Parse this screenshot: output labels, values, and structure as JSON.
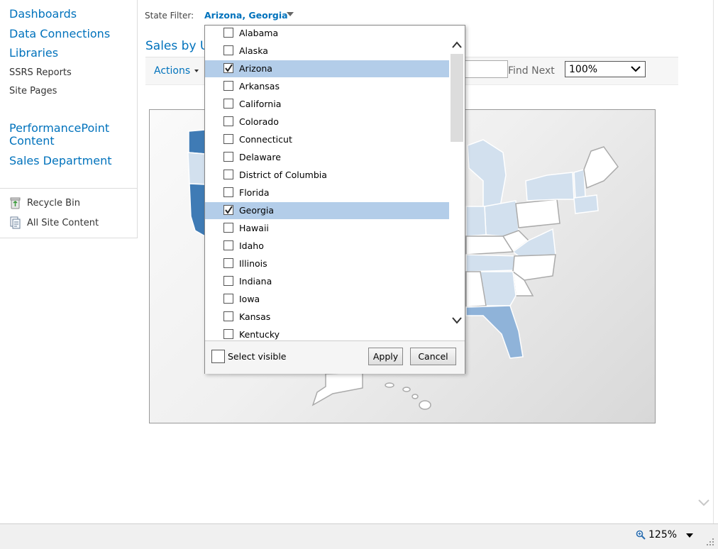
{
  "nav": {
    "items": [
      {
        "label": "Dashboards"
      },
      {
        "label": "Data Connections"
      },
      {
        "label": "Libraries"
      },
      {
        "label": "SSRS Reports"
      },
      {
        "label": "Site Pages"
      },
      {
        "label": "PerformancePoint Content"
      },
      {
        "label": "Sales Department"
      }
    ],
    "utility": [
      {
        "label": "Recycle Bin",
        "icon": "recycle-bin-icon"
      },
      {
        "label": "All Site Content",
        "icon": "site-content-icon"
      }
    ]
  },
  "filter": {
    "label": "State Filter:",
    "value": "Arizona, Georgia"
  },
  "report": {
    "title": "Sales by U"
  },
  "toolbar": {
    "actions_label": "Actions",
    "find_next_label": "Find Next",
    "find_value": "",
    "zoom_value": "100%"
  },
  "dropdown": {
    "options": [
      {
        "label": "Alabama",
        "checked": false
      },
      {
        "label": "Alaska",
        "checked": false
      },
      {
        "label": "Arizona",
        "checked": true
      },
      {
        "label": "Arkansas",
        "checked": false
      },
      {
        "label": "California",
        "checked": false
      },
      {
        "label": "Colorado",
        "checked": false
      },
      {
        "label": "Connecticut",
        "checked": false
      },
      {
        "label": "Delaware",
        "checked": false
      },
      {
        "label": "District of Columbia",
        "checked": false
      },
      {
        "label": "Florida",
        "checked": false
      },
      {
        "label": "Georgia",
        "checked": true
      },
      {
        "label": "Hawaii",
        "checked": false
      },
      {
        "label": "Idaho",
        "checked": false
      },
      {
        "label": "Illinois",
        "checked": false
      },
      {
        "label": "Indiana",
        "checked": false
      },
      {
        "label": "Iowa",
        "checked": false
      },
      {
        "label": "Kansas",
        "checked": false
      },
      {
        "label": "Kentucky",
        "checked": false
      }
    ],
    "select_visible_label": "Select visible",
    "apply_label": "Apply",
    "cancel_label": "Cancel"
  },
  "statusbar": {
    "zoom": "125%"
  },
  "colors": {
    "link": "#0072bc",
    "selected_row": "#b3cde9",
    "map_dark": "#3f7bb5",
    "map_mid": "#8fb3d9",
    "map_light": "#d2e0ee"
  }
}
